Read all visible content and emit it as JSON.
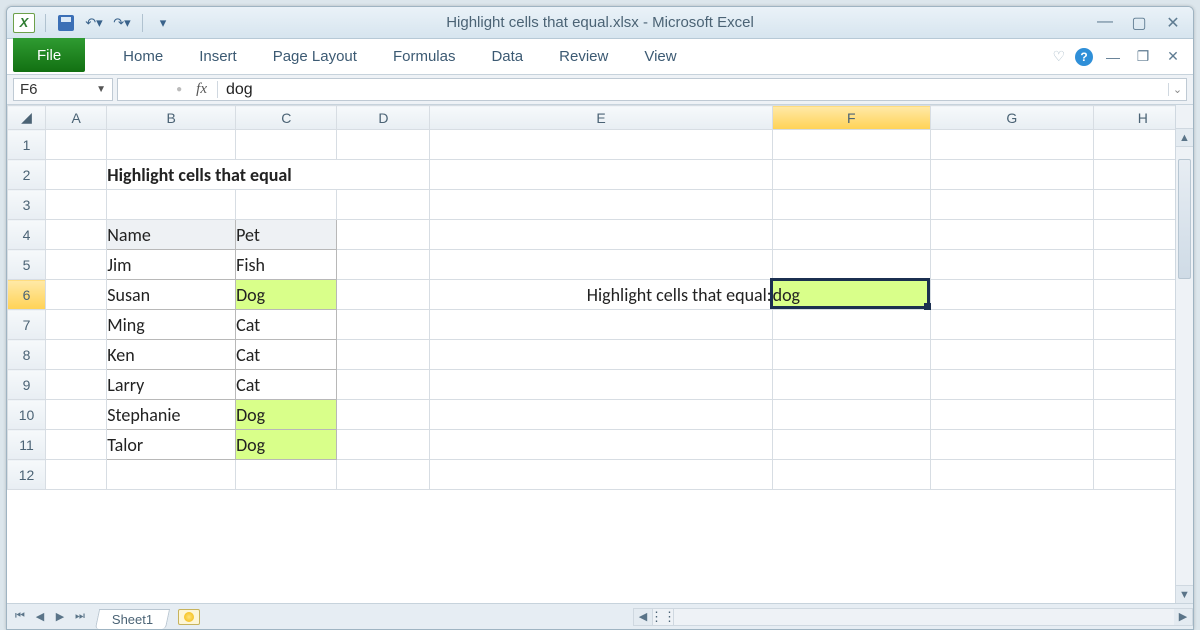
{
  "title": "Highlight cells that equal.xlsx  -  Microsoft Excel",
  "ribbon": {
    "file": "File",
    "tabs": [
      "Home",
      "Insert",
      "Page Layout",
      "Formulas",
      "Data",
      "Review",
      "View"
    ]
  },
  "namebox": "F6",
  "formula": "dog",
  "columns": [
    "A",
    "B",
    "C",
    "D",
    "E",
    "F",
    "G",
    "H"
  ],
  "active_col": "F",
  "rows": [
    "1",
    "2",
    "3",
    "4",
    "5",
    "6",
    "7",
    "8",
    "9",
    "10",
    "11",
    "12"
  ],
  "active_row": "6",
  "sheet": {
    "title": "Highlight cells that equal",
    "headers": {
      "name": "Name",
      "pet": "Pet"
    },
    "data": [
      {
        "name": "Jim",
        "pet": "Fish",
        "hl": false
      },
      {
        "name": "Susan",
        "pet": "Dog",
        "hl": true
      },
      {
        "name": "Ming",
        "pet": "Cat",
        "hl": false
      },
      {
        "name": "Ken",
        "pet": "Cat",
        "hl": false
      },
      {
        "name": "Larry",
        "pet": "Cat",
        "hl": false
      },
      {
        "name": "Stephanie",
        "pet": "Dog",
        "hl": true
      },
      {
        "name": "Talor",
        "pet": "Dog",
        "hl": true
      }
    ],
    "prompt_label": "Highlight cells that equal:",
    "prompt_value": "dog"
  },
  "sheet_tab": "Sheet1"
}
